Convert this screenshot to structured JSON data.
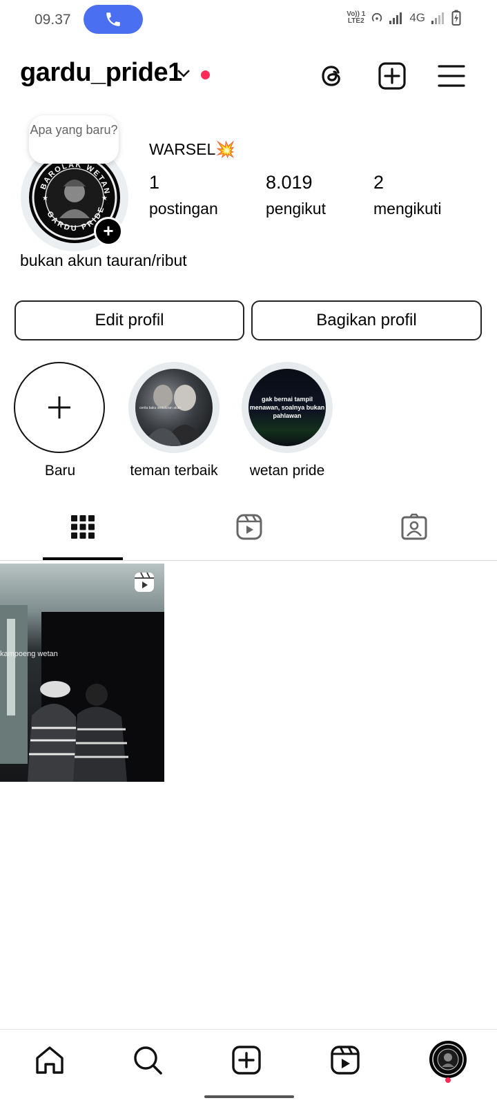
{
  "status_bar": {
    "time": "09.37",
    "network_top": "Vo)) 1",
    "network_bottom": "LTE2",
    "net_type": "4G"
  },
  "header": {
    "username": "gardu_pride1"
  },
  "profile": {
    "bubble_text": "Apa yang baru?",
    "display_name": "WARSEL💥",
    "avatar_text_top": "BAROLAK WETAN",
    "avatar_text_bottom": "GARDU PRIDE",
    "stats": [
      {
        "value": "1",
        "label": "postingan"
      },
      {
        "value": "8.019",
        "label": "pengikut"
      },
      {
        "value": "2",
        "label": "mengikuti"
      }
    ],
    "bio": "bukan akun tauran/ribut"
  },
  "actions": {
    "edit_label": "Edit profil",
    "share_label": "Bagikan profil"
  },
  "highlights": [
    {
      "label": "Baru"
    },
    {
      "label": "teman terbaik",
      "overlay_text": "cerita baku seduluran akan"
    },
    {
      "label": "wetan pride",
      "overlay_text": "gak bernai tampil menawan, soalnya bukan pahlawan"
    }
  ],
  "post": {
    "overlay_text": "kampoeng wetan"
  },
  "colors": {
    "accent_call": "#4a6ff1",
    "notification_dot": "#ff2d55"
  }
}
